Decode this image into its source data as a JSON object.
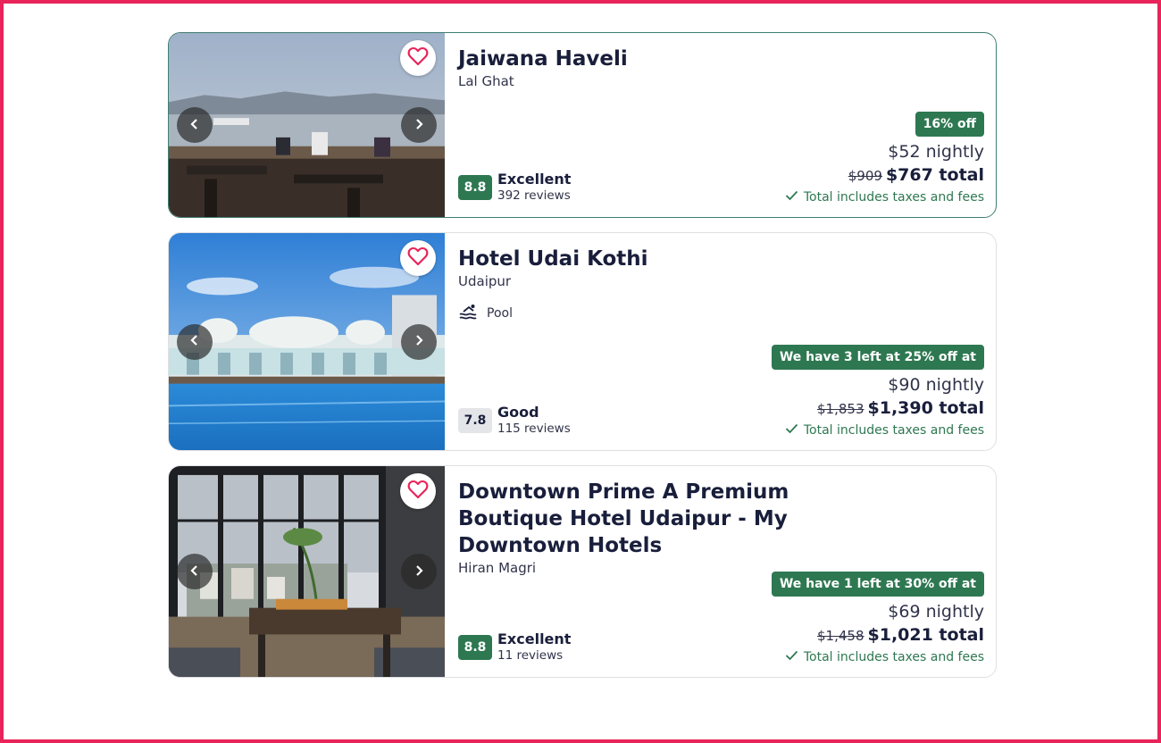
{
  "colors": {
    "accent_green": "#2e7851",
    "heart": "#e8245a",
    "border_selected": "#3f7e72"
  },
  "icons": {
    "favorite": "heart-icon",
    "prev": "chevron-left-icon",
    "next": "chevron-right-icon",
    "pool": "pool-icon",
    "check": "checkmark-icon"
  },
  "hotels": [
    {
      "name": "Jaiwana Haveli",
      "location": "Lal Ghat",
      "amenity": "",
      "score": "8.8",
      "rating_label": "Excellent",
      "reviews": "392 reviews",
      "badge": "16% off",
      "nightly": "$52 nightly",
      "old_total": "$909",
      "total": "$767 total",
      "taxes_note": "Total includes taxes and fees"
    },
    {
      "name": "Hotel Udai Kothi",
      "location": "Udaipur",
      "amenity": "Pool",
      "score": "7.8",
      "rating_label": "Good",
      "reviews": "115 reviews",
      "badge": "We have 3 left at 25% off at",
      "nightly": "$90 nightly",
      "old_total": "$1,853",
      "total": "$1,390 total",
      "taxes_note": "Total includes taxes and fees"
    },
    {
      "name": "Downtown Prime A Premium Boutique Hotel Udaipur - My Downtown Hotels",
      "location": "Hiran Magri",
      "amenity": "",
      "score": "8.8",
      "rating_label": "Excellent",
      "reviews": "11 reviews",
      "badge": "We have 1 left at 30% off at",
      "nightly": "$69 nightly",
      "old_total": "$1,458",
      "total": "$1,021 total",
      "taxes_note": "Total includes taxes and fees"
    }
  ]
}
